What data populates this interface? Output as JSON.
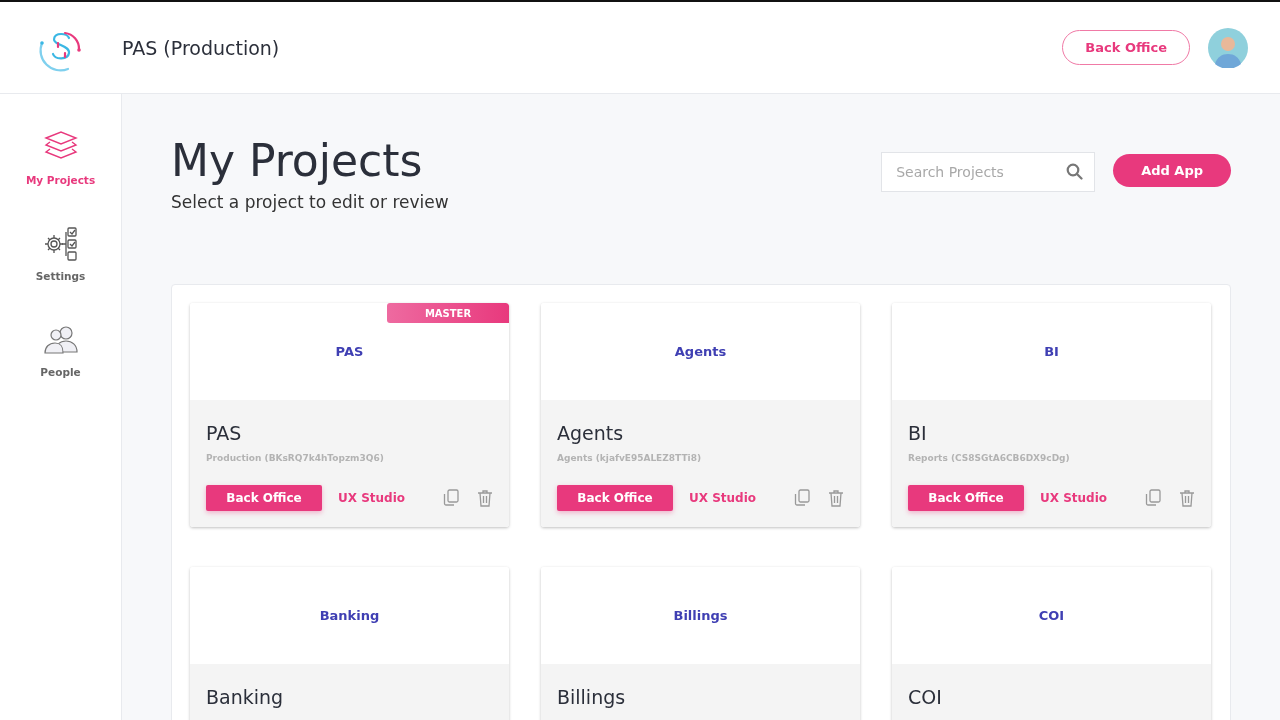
{
  "header": {
    "title": "PAS (Production)",
    "button": "Back Office"
  },
  "sidebar": {
    "items": [
      {
        "label": "My Projects",
        "selected": true
      },
      {
        "label": "Settings",
        "selected": false
      },
      {
        "label": "People",
        "selected": false
      }
    ]
  },
  "page": {
    "title": "My Projects",
    "subtitle": "Select a project to edit or review"
  },
  "search": {
    "placeholder": "Search Projects"
  },
  "add_button": "Add App",
  "projects": [
    {
      "banner": "PAS",
      "badge": "MASTER",
      "name": "PAS",
      "detail": "Production (BKsRQ7k4hTopzm3Q6)",
      "primary": "Back Office",
      "secondary": "UX Studio"
    },
    {
      "banner": "Agents",
      "name": "Agents",
      "detail": "Agents (kjafvE95ALEZ8TTi8)",
      "primary": "Back Office",
      "secondary": "UX Studio"
    },
    {
      "banner": "BI",
      "name": "BI",
      "detail": "Reports (CS8SGtA6CB6DX9cDg)",
      "primary": "Back Office",
      "secondary": "UX Studio"
    },
    {
      "banner": "Banking",
      "name": "Banking"
    },
    {
      "banner": "Billings",
      "name": "Billings"
    },
    {
      "banner": "COI",
      "name": "COI"
    }
  ]
}
